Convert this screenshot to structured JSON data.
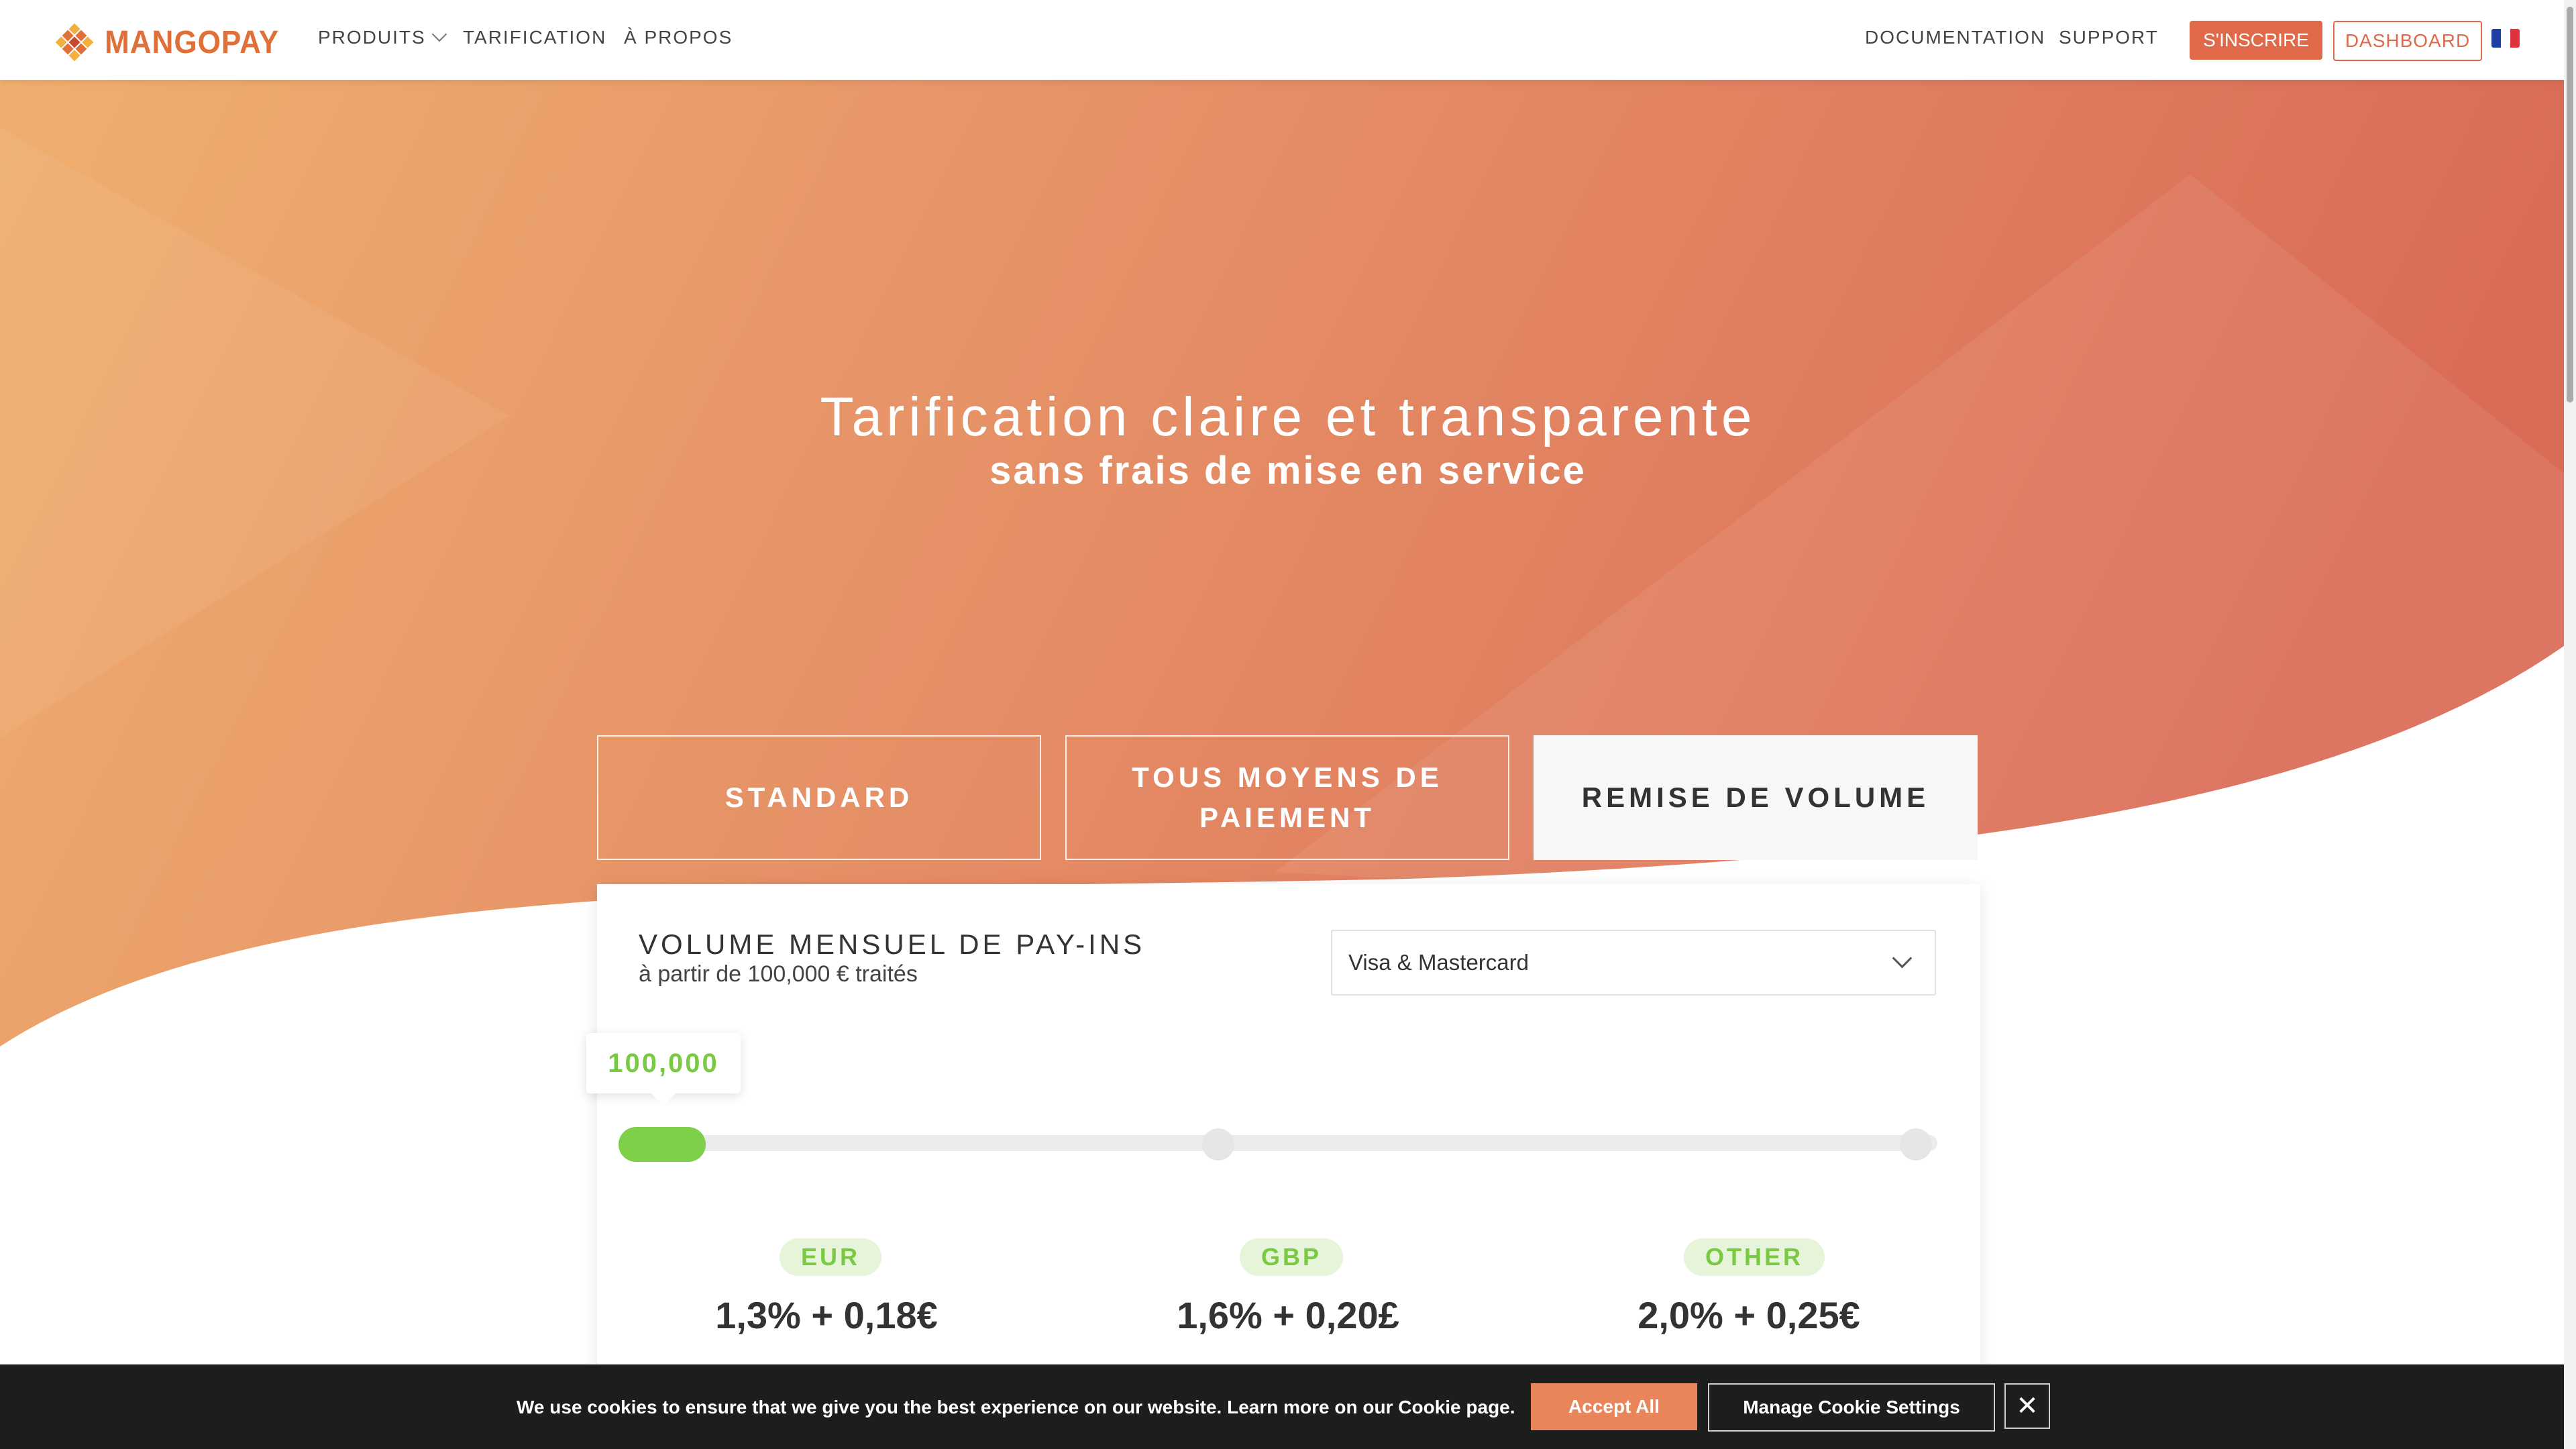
{
  "nav": {
    "brand": "MANGOPAY",
    "links": [
      "PRODUITS",
      "TARIFICATION",
      "À PROPOS"
    ],
    "right_links": [
      "DOCUMENTATION",
      "SUPPORT"
    ],
    "signup": "S'INSCRIRE",
    "dashboard": "DASHBOARD",
    "language_flag": "fr-flag-icon"
  },
  "hero": {
    "title": "Tarification claire et transparente",
    "subtitle": "sans frais de mise en service"
  },
  "tabs": [
    {
      "label": "STANDARD",
      "active": false
    },
    {
      "label": "TOUS MOYENS DE PAIEMENT",
      "active": false
    },
    {
      "label": "REMISE DE VOLUME",
      "active": true
    }
  ],
  "volume": {
    "title": "VOLUME MENSUEL DE PAY-INS",
    "subtitle": "à partir de 100,000 € traités",
    "select_value": "Visa & Mastercard",
    "slider_value": "100,000",
    "slider_level": 0
  },
  "prices": [
    {
      "currency": "EUR",
      "price": "1,3% + 0,18€"
    },
    {
      "currency": "GBP",
      "price": "1,6% + 0,20£"
    },
    {
      "currency": "OTHER",
      "price": "2,0% + 0,25€"
    }
  ],
  "cookie": {
    "text": "We use cookies to ensure that we give you the best experience on our website. Learn more on our Cookie page.",
    "accept": "Accept All",
    "manage": "Manage Cookie Settings",
    "close": "✕"
  },
  "colors": {
    "accent": "#e0694a",
    "green": "#7ac943",
    "hero_left": "#efa463",
    "hero_right": "#dc6c58"
  }
}
